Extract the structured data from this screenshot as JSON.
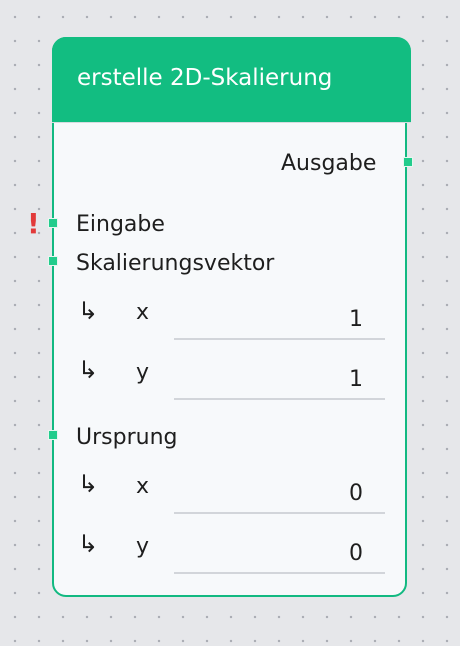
{
  "node": {
    "title": "erstelle 2D-Skalierung",
    "output_label": "Ausgabe",
    "input_label": "Eingabe",
    "error_indicator": "!",
    "scale_vector": {
      "label": "Skalierungsvektor",
      "arrow": "↳",
      "x_label": "x",
      "x_value": "1",
      "y_label": "y",
      "y_value": "1"
    },
    "origin": {
      "label": "Ursprung",
      "arrow": "↳",
      "x_label": "x",
      "x_value": "0",
      "y_label": "y",
      "y_value": "0"
    }
  },
  "colors": {
    "header": "#12bd81",
    "border": "#12b981",
    "port": "#22cc8c",
    "error": "#e23a3a",
    "canvas": "#e6e7ea"
  }
}
